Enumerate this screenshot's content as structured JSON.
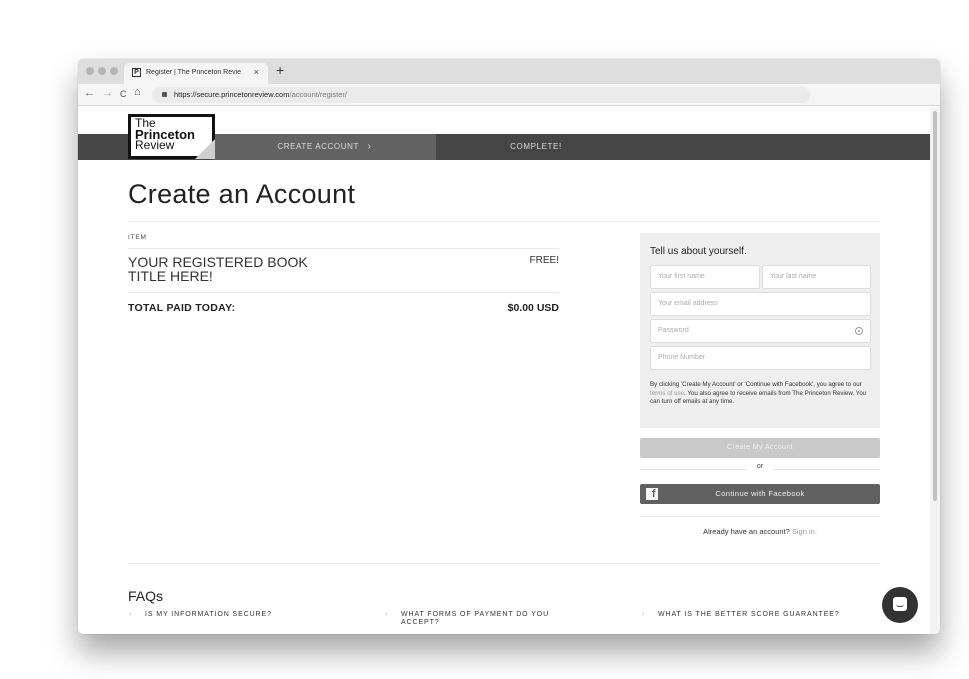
{
  "browser": {
    "tab_title": "Register | The Princeton Revie",
    "tab_favicon": "P",
    "new_tab": "+",
    "close_tab": "×",
    "url_host": "https://secure.princetonreview.com",
    "url_path": "/account/register/",
    "nav": {
      "back": "←",
      "forward": "→",
      "reload": "C",
      "home": "⌂"
    }
  },
  "logo": {
    "line1": "The",
    "line2": "Princeton",
    "line3": "Review"
  },
  "steps": [
    {
      "label": "CREATE ACCOUNT",
      "active": true,
      "chevron": "›"
    },
    {
      "label": "COMPLETE!",
      "active": false
    }
  ],
  "page": {
    "title": "Create an Account",
    "item_header": "ITEM",
    "item_name": "YOUR REGISTERED BOOK TITLE HERE!",
    "item_price": "FREE!",
    "total_label": "TOTAL PAID TODAY:",
    "total_value": "$0.00 USD"
  },
  "form": {
    "title": "Tell us about yourself.",
    "first_name_placeholder": "Your first name",
    "last_name_placeholder": "Your last name",
    "email_placeholder": "Your email address",
    "password_placeholder": "Password",
    "phone_placeholder": "Phone Number",
    "terms_before": "By clicking 'Create My Account' or 'Continue with Facebook', you agree to our ",
    "terms_link": "terms of use",
    "terms_after": ". You also agree to receive emails from The Princeton Review. You can turn off emails at any time.",
    "create_button": "Create My Account",
    "or": "or",
    "facebook_button": "Continue with Facebook",
    "facebook_icon": "f",
    "signin_prompt": "Already have an account?",
    "signin_link": "Sign in."
  },
  "faqs": {
    "title": "FAQs",
    "chevron": "›",
    "items": [
      "IS MY INFORMATION SECURE?",
      "WHAT FORMS OF PAYMENT DO YOU ACCEPT?",
      "WHAT IS THE BETTER SCORE GUARANTEE?"
    ]
  }
}
